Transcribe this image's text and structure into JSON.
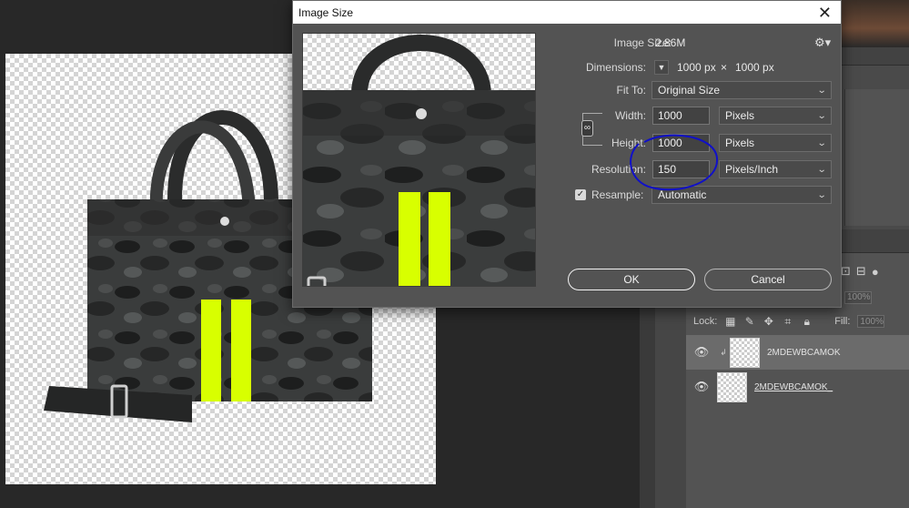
{
  "dialog": {
    "title": "Image Size",
    "image_size_label": "Image Size:",
    "image_size_value": "2.86M",
    "dimensions_label": "Dimensions:",
    "dimensions_width": "1000 px",
    "dimensions_times": "×",
    "dimensions_height": "1000 px",
    "fit_to_label": "Fit To:",
    "fit_to_value": "Original Size",
    "width_label": "Width:",
    "width_value": "1000",
    "width_unit": "Pixels",
    "height_label": "Height:",
    "height_value": "1000",
    "height_unit": "Pixels",
    "resolution_label": "Resolution:",
    "resolution_value": "150",
    "resolution_unit": "Pixels/Inch",
    "resample_label": "Resample:",
    "resample_checked": true,
    "resample_value": "Automatic",
    "ok_label": "OK",
    "cancel_label": "Cancel",
    "annotation_color": "#1010c8"
  },
  "layers": {
    "lock_label": "Lock:",
    "fill_label": "Fill:",
    "opacity_value": "100%",
    "fill_value": "100%",
    "items": [
      {
        "name": "2MDEWBCAMOK",
        "selected": true
      },
      {
        "name": "2MDEWBCAMOK_",
        "selected": false
      }
    ]
  },
  "colors": {
    "stripe": "#d8ff00",
    "bag": "#2f3131",
    "dialog_bg": "#535353"
  }
}
